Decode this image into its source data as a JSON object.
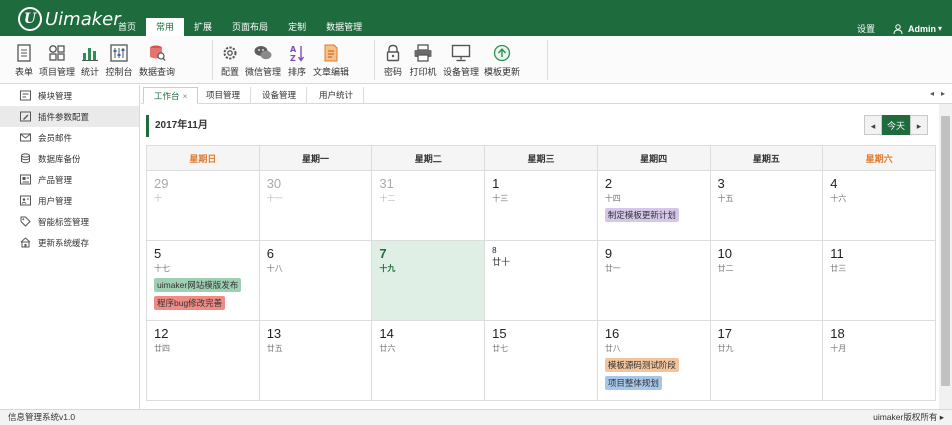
{
  "brand": {
    "logo_letter": "U",
    "name": "Uimaker"
  },
  "menu": [
    {
      "label": "首页"
    },
    {
      "label": "常用",
      "active": true
    },
    {
      "label": "扩展"
    },
    {
      "label": "页面布局"
    },
    {
      "label": "定制"
    },
    {
      "label": "数据管理"
    }
  ],
  "topright": {
    "settings": "设置",
    "user": "Admin",
    "user_caret": "▾"
  },
  "toolbar": {
    "groups": [
      [
        {
          "label": "表单",
          "icon": "form-icon"
        },
        {
          "label": "项目管理",
          "icon": "grid-icon",
          "dropdown": true
        },
        {
          "label": "统计",
          "icon": "bar-chart-icon"
        },
        {
          "label": "控制台",
          "icon": "sliders-icon",
          "dropdown": true
        },
        {
          "label": "数据查询",
          "icon": "database-search-icon",
          "dropdown": true
        }
      ],
      [
        {
          "label": "配置",
          "icon": "gear-icon"
        },
        {
          "label": "微信管理",
          "icon": "wechat-icon",
          "dropdown": true
        },
        {
          "label": "排序",
          "icon": "sort-az-icon"
        },
        {
          "label": "文章编辑",
          "icon": "document-edit-icon",
          "dropdown": true
        }
      ],
      [
        {
          "label": "密码",
          "icon": "lock-icon"
        },
        {
          "label": "打印机",
          "icon": "printer-icon"
        },
        {
          "label": "设备管理",
          "icon": "monitor-icon"
        },
        {
          "label": "模板更新",
          "icon": "upload-circle-icon"
        }
      ]
    ]
  },
  "sidebar": {
    "items": [
      {
        "label": "模块管理",
        "icon": "module-icon"
      },
      {
        "label": "插件参数配置",
        "icon": "plugin-icon",
        "active": true
      },
      {
        "label": "会员邮件",
        "icon": "mail-icon"
      },
      {
        "label": "数据库备份",
        "icon": "database-icon"
      },
      {
        "label": "产品管理",
        "icon": "product-icon"
      },
      {
        "label": "用户管理",
        "icon": "user-doc-icon"
      },
      {
        "label": "智能标签管理",
        "icon": "tag-icon"
      },
      {
        "label": "更新系统缓存",
        "icon": "home-icon"
      }
    ]
  },
  "tabs": [
    {
      "label": "工作台",
      "closable": true,
      "active": true
    },
    {
      "label": "项目管理"
    },
    {
      "label": "设备管理"
    },
    {
      "label": "用户统计"
    }
  ],
  "tab_close": "×",
  "tab_arrows": {
    "left": "◂",
    "right": "▸"
  },
  "calendar": {
    "month": "2017年11月",
    "today_label": "今天",
    "prev": "◂",
    "next": "▸",
    "weekdays": [
      {
        "label": "星期日",
        "weekend": true
      },
      {
        "label": "星期一"
      },
      {
        "label": "星期二"
      },
      {
        "label": "星期三"
      },
      {
        "label": "星期四"
      },
      {
        "label": "星期五"
      },
      {
        "label": "星期六",
        "weekend": true
      }
    ],
    "weeks": [
      [
        {
          "d": "29",
          "lunar": "十",
          "other": true
        },
        {
          "d": "30",
          "lunar": "十一",
          "other": true
        },
        {
          "d": "31",
          "lunar": "十二",
          "other": true
        },
        {
          "d": "1",
          "lunar": "十三"
        },
        {
          "d": "2",
          "lunar": "十四",
          "events": [
            {
              "text": "制定模板更新计划",
              "color": "#d6c7ea"
            }
          ]
        },
        {
          "d": "3",
          "lunar": "十五"
        },
        {
          "d": "4",
          "lunar": "十六"
        }
      ],
      [
        {
          "d": "5",
          "lunar": "十七",
          "events": [
            {
              "text": "uimaker网站模版发布",
              "color": "#9fd0b4"
            },
            {
              "text": "程序bug修改完善",
              "color": "#ef8c86"
            }
          ]
        },
        {
          "d": "6",
          "lunar": "十八"
        },
        {
          "d": "7",
          "lunar": "十九",
          "today": true
        },
        {
          "d": "8",
          "lunar": "廿十",
          "small": true
        },
        {
          "d": "9",
          "lunar": "廿一"
        },
        {
          "d": "10",
          "lunar": "廿二"
        },
        {
          "d": "11",
          "lunar": "廿三"
        }
      ],
      [
        {
          "d": "12",
          "lunar": "廿四"
        },
        {
          "d": "13",
          "lunar": "廿五"
        },
        {
          "d": "14",
          "lunar": "廿六"
        },
        {
          "d": "15",
          "lunar": "廿七"
        },
        {
          "d": "16",
          "lunar": "廿八",
          "events": [
            {
              "text": "模板源码测试阶段",
              "color": "#f1c49b"
            },
            {
              "text": "项目整体规划",
              "color": "#a6c7ea"
            }
          ]
        },
        {
          "d": "17",
          "lunar": "廿九"
        },
        {
          "d": "18",
          "lunar": "十月"
        }
      ]
    ]
  },
  "status": {
    "left": "信息管理系统v1.0",
    "right": "uimaker版权所有",
    "right_arrow": "▸"
  },
  "colors": {
    "brand": "#1e6b3e",
    "weekend": "#e07a2c",
    "today_bg": "#e0efe6"
  }
}
